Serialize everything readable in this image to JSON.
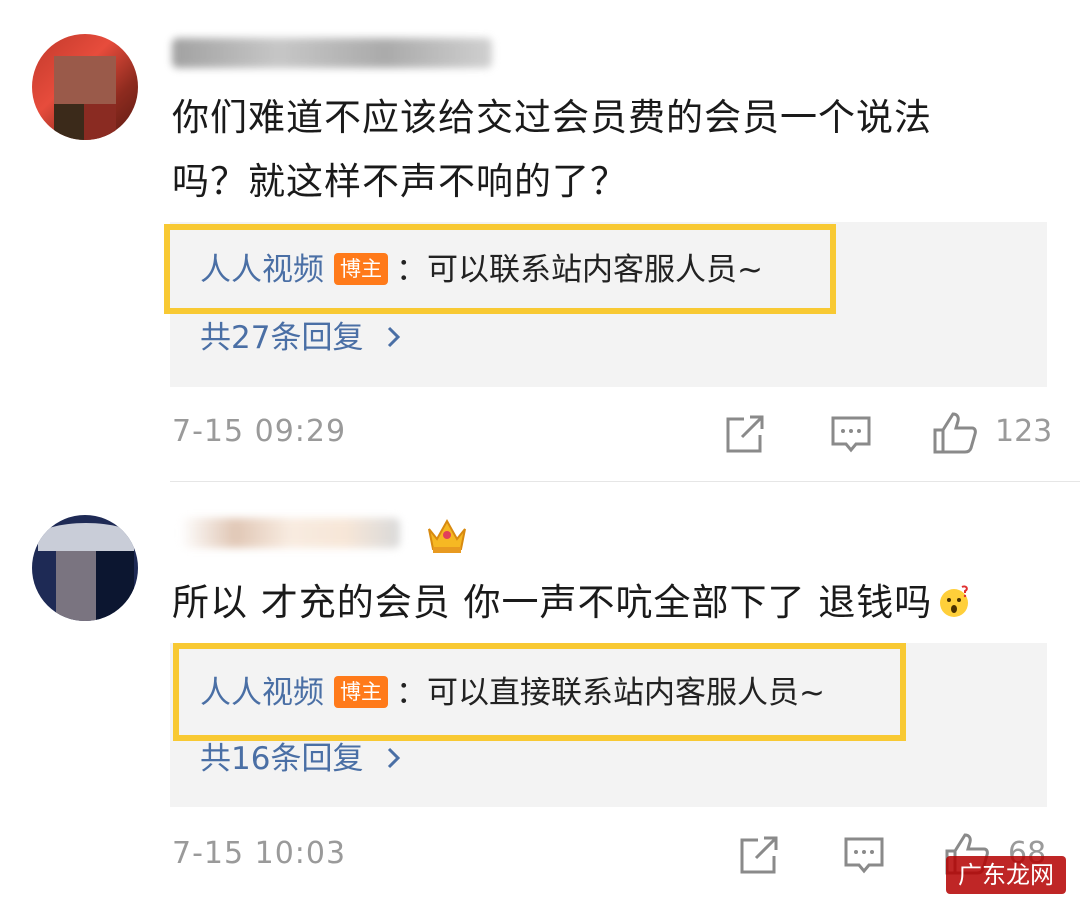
{
  "comments": [
    {
      "body_line1": "你们难道不应该给交过会员费的会员一个说法",
      "body_line2": "吗？就这样不声不响的了？",
      "reply": {
        "author": "人人视频",
        "badge": "博主",
        "text": "：可以联系站内客服人员~"
      },
      "reply_count": "共27条回复",
      "time": "7-15 09:29",
      "like_count": "123"
    },
    {
      "body_line1": "所以 才充的会员 你一声不吭全部下了 退钱吗",
      "reply": {
        "author": "人人视频",
        "badge": "博主",
        "text": "：可以直接联系站内客服人员~"
      },
      "reply_count": "共16条回复",
      "time": "7-15 10:03",
      "like_count": "68"
    }
  ],
  "icons": {
    "share": "share-icon",
    "comment": "comment-icon",
    "like": "thumbs-up-icon",
    "crown": "crown-icon",
    "emoji": "surprised-face-icon",
    "chevron": "chevron-right-icon"
  },
  "colors": {
    "highlight": "#f8c933",
    "reply_author": "#4a6fa5",
    "badge": "#ff7a1a",
    "meta": "#9a9a9a"
  },
  "watermark": "广东龙网"
}
